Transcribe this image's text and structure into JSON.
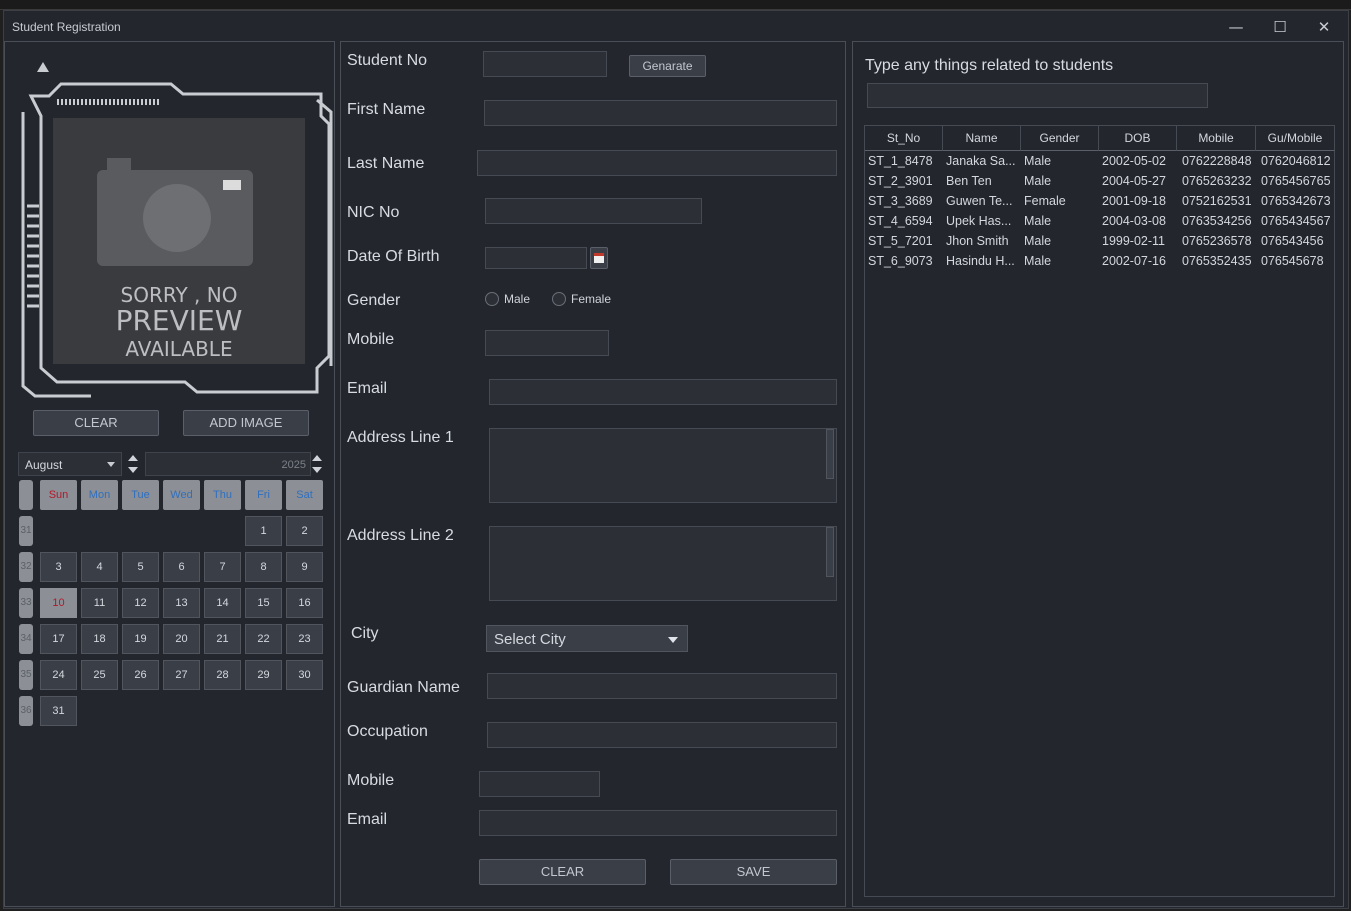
{
  "window": {
    "title": "Student Registration"
  },
  "preview": {
    "line1": "SORRY , NO",
    "line2": "PREVIEW",
    "line3": "AVAILABLE"
  },
  "left": {
    "clear_label": "CLEAR",
    "add_image_label": "ADD IMAGE"
  },
  "calendar": {
    "month": "August",
    "year": "2025",
    "weekday_headers": [
      "Sun",
      "Mon",
      "Tue",
      "Wed",
      "Thu",
      "Fri",
      "Sat"
    ],
    "week_numbers": [
      "31",
      "32",
      "33",
      "34",
      "35",
      "36"
    ],
    "days": [
      [
        null,
        null,
        null,
        null,
        null,
        "1",
        "2"
      ],
      [
        "3",
        "4",
        "5",
        "6",
        "7",
        "8",
        "9"
      ],
      [
        "10",
        "11",
        "12",
        "13",
        "14",
        "15",
        "16"
      ],
      [
        "17",
        "18",
        "19",
        "20",
        "21",
        "22",
        "23"
      ],
      [
        "24",
        "25",
        "26",
        "27",
        "28",
        "29",
        "30"
      ],
      [
        "31",
        null,
        null,
        null,
        null,
        null,
        null
      ]
    ],
    "selected_day": "10"
  },
  "form": {
    "student_no_label": "Student No",
    "generate_label": "Genarate",
    "first_name_label": "First Name",
    "last_name_label": "Last Name",
    "nic_label": "NIC No",
    "dob_label": "Date Of Birth",
    "gender_label": "Gender",
    "gender_male": "Male",
    "gender_female": "Female",
    "mobile_label": "Mobile",
    "email_label": "Email",
    "address1_label": "Address Line 1",
    "address2_label": "Address Line 2",
    "city_label": "City",
    "city_select": "Select City",
    "guardian_name_label": "Guardian Name",
    "occupation_label": "Occupation",
    "guardian_mobile_label": "Mobile",
    "guardian_email_label": "Email",
    "clear_label": "CLEAR",
    "save_label": "SAVE"
  },
  "search": {
    "label": "Type any things related to students",
    "value": ""
  },
  "table": {
    "columns": [
      "St_No",
      "Name",
      "Gender",
      "DOB",
      "Mobile",
      "Gu/Mobile"
    ],
    "rows": [
      [
        "ST_1_8478",
        "Janaka Sa...",
        "Male",
        "2002-05-02",
        "0762228848",
        "0762046812"
      ],
      [
        "ST_2_3901",
        "Ben Ten",
        "Male",
        "2004-05-27",
        "0765263232",
        "0765456765"
      ],
      [
        "ST_3_3689",
        "Guwen Te...",
        "Female",
        "2001-09-18",
        "0752162531",
        "0765342673"
      ],
      [
        "ST_4_6594",
        "Upek  Has...",
        "Male",
        "2004-03-08",
        "0763534256",
        "0765434567"
      ],
      [
        "ST_5_7201",
        "Jhon Smith",
        "Male",
        "1999-02-11",
        "0765236578",
        "076543456"
      ],
      [
        "ST_6_9073",
        "Hasindu H...",
        "Male",
        "2002-07-16",
        "0765352435",
        "076545678"
      ]
    ]
  }
}
